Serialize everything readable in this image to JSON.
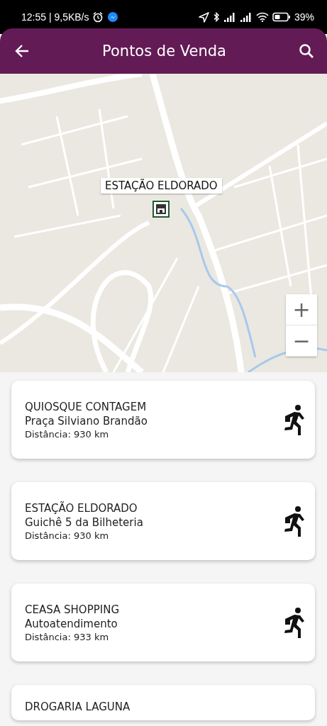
{
  "status_bar": {
    "time": "12:55 | 9,5KB/s",
    "battery": "39%"
  },
  "app_bar": {
    "title": "Pontos de Venda"
  },
  "map": {
    "kind": "picture",
    "marker_label": "ESTAÇÃO ELDORADO",
    "zoom_in": "+",
    "zoom_out": "−"
  },
  "points": [
    {
      "name": "QUIOSQUE CONTAGEM",
      "place": "Praça Silviano Brandão",
      "distance": "Distância: 930 km"
    },
    {
      "name": "ESTAÇÃO ELDORADO",
      "place": "Guichê 5 da Bilheteria",
      "distance": "Distância: 930 km"
    },
    {
      "name": "CEASA SHOPPING",
      "place": "Autoatendimento",
      "distance": "Distância: 933 km"
    },
    {
      "name": "DROGARIA LAGUNA"
    }
  ]
}
